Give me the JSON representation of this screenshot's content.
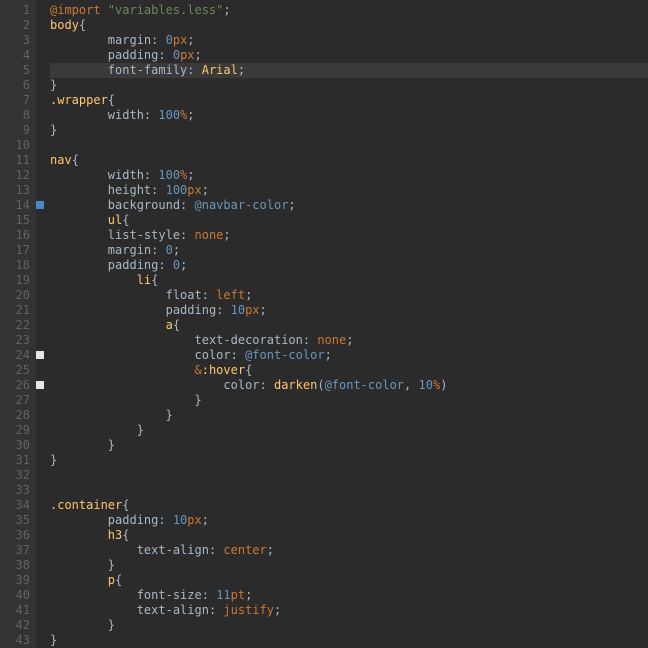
{
  "editor": {
    "filename_hint": "variables.less",
    "line_count": 43,
    "current_line": 5,
    "breakpoints": [
      {
        "line": 14,
        "color": "blue"
      },
      {
        "line": 24,
        "color": "white"
      },
      {
        "line": 26,
        "color": "white"
      }
    ],
    "lines": [
      {
        "n": 1,
        "tokens": [
          [
            "@import ",
            "kw"
          ],
          [
            "\"variables.less\"",
            "str"
          ],
          [
            ";",
            "punct"
          ]
        ],
        "indent": 0
      },
      {
        "n": 2,
        "tokens": [
          [
            "body",
            "sel"
          ],
          [
            "{",
            "punct"
          ]
        ],
        "indent": 0
      },
      {
        "n": 3,
        "tokens": [
          [
            "margin",
            "prop"
          ],
          [
            ": ",
            "punct"
          ],
          [
            "0",
            "num"
          ],
          [
            "px",
            "unit"
          ],
          [
            ";",
            "punct"
          ]
        ],
        "indent": 2
      },
      {
        "n": 4,
        "tokens": [
          [
            "padding",
            "prop"
          ],
          [
            ": ",
            "punct"
          ],
          [
            "0",
            "num"
          ],
          [
            "px",
            "unit"
          ],
          [
            ";",
            "punct"
          ]
        ],
        "indent": 2
      },
      {
        "n": 5,
        "tokens": [
          [
            "font-family",
            "prop"
          ],
          [
            ": ",
            "punct"
          ],
          [
            "Arial",
            "sel"
          ],
          [
            ";",
            "punct"
          ]
        ],
        "indent": 2,
        "current": true
      },
      {
        "n": 6,
        "tokens": [
          [
            "}",
            "punct"
          ]
        ],
        "indent": 0
      },
      {
        "n": 7,
        "tokens": [
          [
            ".wrapper",
            "sel"
          ],
          [
            "{",
            "punct"
          ]
        ],
        "indent": 0
      },
      {
        "n": 8,
        "tokens": [
          [
            "width",
            "prop"
          ],
          [
            ": ",
            "punct"
          ],
          [
            "100",
            "num"
          ],
          [
            "%",
            "pct"
          ],
          [
            ";",
            "punct"
          ]
        ],
        "indent": 2
      },
      {
        "n": 9,
        "tokens": [
          [
            "}",
            "punct"
          ]
        ],
        "indent": 0
      },
      {
        "n": 10,
        "tokens": [],
        "indent": 0
      },
      {
        "n": 11,
        "tokens": [
          [
            "nav",
            "sel"
          ],
          [
            "{",
            "punct"
          ]
        ],
        "indent": 0
      },
      {
        "n": 12,
        "tokens": [
          [
            "width",
            "prop"
          ],
          [
            ": ",
            "punct"
          ],
          [
            "100",
            "num"
          ],
          [
            "%",
            "pct"
          ],
          [
            ";",
            "punct"
          ]
        ],
        "indent": 2
      },
      {
        "n": 13,
        "tokens": [
          [
            "height",
            "prop"
          ],
          [
            ": ",
            "punct"
          ],
          [
            "100",
            "num"
          ],
          [
            "px",
            "unit"
          ],
          [
            ";",
            "punct"
          ]
        ],
        "indent": 2
      },
      {
        "n": 14,
        "tokens": [
          [
            "background",
            "prop"
          ],
          [
            ": ",
            "punct"
          ],
          [
            "@navbar-color",
            "var"
          ],
          [
            ";",
            "punct"
          ]
        ],
        "indent": 2
      },
      {
        "n": 15,
        "tokens": [
          [
            "ul",
            "sel"
          ],
          [
            "{",
            "punct"
          ]
        ],
        "indent": 2
      },
      {
        "n": 16,
        "tokens": [
          [
            "list-style",
            "prop"
          ],
          [
            ": ",
            "punct"
          ],
          [
            "none",
            "kw"
          ],
          [
            ";",
            "punct"
          ]
        ],
        "indent": 2
      },
      {
        "n": 17,
        "tokens": [
          [
            "margin",
            "prop"
          ],
          [
            ": ",
            "punct"
          ],
          [
            "0",
            "num"
          ],
          [
            ";",
            "punct"
          ]
        ],
        "indent": 2
      },
      {
        "n": 18,
        "tokens": [
          [
            "padding",
            "prop"
          ],
          [
            ": ",
            "punct"
          ],
          [
            "0",
            "num"
          ],
          [
            ";",
            "punct"
          ]
        ],
        "indent": 2
      },
      {
        "n": 19,
        "tokens": [
          [
            "li",
            "sel"
          ],
          [
            "{",
            "punct"
          ]
        ],
        "indent": 3
      },
      {
        "n": 20,
        "tokens": [
          [
            "float",
            "prop"
          ],
          [
            ": ",
            "punct"
          ],
          [
            "left",
            "kw"
          ],
          [
            ";",
            "punct"
          ]
        ],
        "indent": 4
      },
      {
        "n": 21,
        "tokens": [
          [
            "padding",
            "prop"
          ],
          [
            ": ",
            "punct"
          ],
          [
            "10",
            "num"
          ],
          [
            "px",
            "unit"
          ],
          [
            ";",
            "punct"
          ]
        ],
        "indent": 4
      },
      {
        "n": 22,
        "tokens": [
          [
            "a",
            "sel"
          ],
          [
            "{",
            "punct"
          ]
        ],
        "indent": 4
      },
      {
        "n": 23,
        "tokens": [
          [
            "text-decoration",
            "prop"
          ],
          [
            ": ",
            "punct"
          ],
          [
            "none",
            "kw"
          ],
          [
            ";",
            "punct"
          ]
        ],
        "indent": 5
      },
      {
        "n": 24,
        "tokens": [
          [
            "color",
            "prop"
          ],
          [
            ": ",
            "punct"
          ],
          [
            "@font-color",
            "var"
          ],
          [
            ";",
            "punct"
          ]
        ],
        "indent": 5
      },
      {
        "n": 25,
        "tokens": [
          [
            "&",
            "kw"
          ],
          [
            ":hover",
            "sel"
          ],
          [
            "{",
            "punct"
          ]
        ],
        "indent": 5
      },
      {
        "n": 26,
        "tokens": [
          [
            "color",
            "prop"
          ],
          [
            ": ",
            "punct"
          ],
          [
            "darken",
            "func"
          ],
          [
            "(",
            "punct"
          ],
          [
            "@font-color",
            "var"
          ],
          [
            ", ",
            "punct"
          ],
          [
            "10",
            "num"
          ],
          [
            "%",
            "pct"
          ],
          [
            ")",
            "punct"
          ]
        ],
        "indent": 6
      },
      {
        "n": 27,
        "tokens": [
          [
            "}",
            "punct"
          ]
        ],
        "indent": 5
      },
      {
        "n": 28,
        "tokens": [
          [
            "}",
            "punct"
          ]
        ],
        "indent": 4
      },
      {
        "n": 29,
        "tokens": [
          [
            "}",
            "punct"
          ]
        ],
        "indent": 3
      },
      {
        "n": 30,
        "tokens": [
          [
            "}",
            "punct"
          ]
        ],
        "indent": 2
      },
      {
        "n": 31,
        "tokens": [
          [
            "}",
            "punct"
          ]
        ],
        "indent": 0
      },
      {
        "n": 32,
        "tokens": [],
        "indent": 0
      },
      {
        "n": 33,
        "tokens": [],
        "indent": 0
      },
      {
        "n": 34,
        "tokens": [
          [
            ".container",
            "sel"
          ],
          [
            "{",
            "punct"
          ]
        ],
        "indent": 0
      },
      {
        "n": 35,
        "tokens": [
          [
            "padding",
            "prop"
          ],
          [
            ": ",
            "punct"
          ],
          [
            "10",
            "num"
          ],
          [
            "px",
            "unit"
          ],
          [
            ";",
            "punct"
          ]
        ],
        "indent": 2
      },
      {
        "n": 36,
        "tokens": [
          [
            "h3",
            "sel"
          ],
          [
            "{",
            "punct"
          ]
        ],
        "indent": 2
      },
      {
        "n": 37,
        "tokens": [
          [
            "text-align",
            "prop"
          ],
          [
            ": ",
            "punct"
          ],
          [
            "center",
            "kw"
          ],
          [
            ";",
            "punct"
          ]
        ],
        "indent": 3
      },
      {
        "n": 38,
        "tokens": [
          [
            "}",
            "punct"
          ]
        ],
        "indent": 2
      },
      {
        "n": 39,
        "tokens": [
          [
            "p",
            "sel"
          ],
          [
            "{",
            "punct"
          ]
        ],
        "indent": 2
      },
      {
        "n": 40,
        "tokens": [
          [
            "font-size",
            "prop"
          ],
          [
            ": ",
            "punct"
          ],
          [
            "11",
            "num"
          ],
          [
            "pt",
            "unit"
          ],
          [
            ";",
            "punct"
          ]
        ],
        "indent": 3
      },
      {
        "n": 41,
        "tokens": [
          [
            "text-align",
            "prop"
          ],
          [
            ": ",
            "punct"
          ],
          [
            "justify",
            "kw"
          ],
          [
            ";",
            "punct"
          ]
        ],
        "indent": 3
      },
      {
        "n": 42,
        "tokens": [
          [
            "}",
            "punct"
          ]
        ],
        "indent": 2
      },
      {
        "n": 43,
        "tokens": [
          [
            "}",
            "punct"
          ]
        ],
        "indent": 0
      }
    ]
  }
}
